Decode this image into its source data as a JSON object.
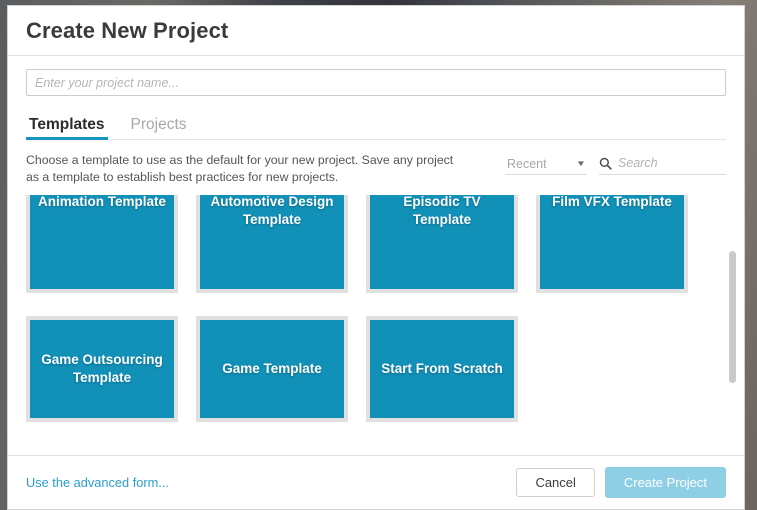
{
  "window": {
    "title": "Create New Project"
  },
  "project_name": {
    "placeholder": "Enter your project name...",
    "value": ""
  },
  "tabs": [
    {
      "label": "Templates",
      "active": true
    },
    {
      "label": "Projects",
      "active": false
    }
  ],
  "description": "Choose a template to use as the default for your new project. Save any project as a template to establish best practices for new projects.",
  "filters": {
    "sort": {
      "selected": "Recent",
      "caret_icon": "chevron-down-icon"
    },
    "search": {
      "icon": "search-icon",
      "placeholder": "Search",
      "value": ""
    }
  },
  "templates": [
    {
      "label": "Animation Template"
    },
    {
      "label": "Automotive Design Template"
    },
    {
      "label": "Episodic TV Template"
    },
    {
      "label": "Film VFX Template"
    },
    {
      "label": "Game Outsourcing Template"
    },
    {
      "label": "Game Template"
    },
    {
      "label": "Start From Scratch"
    }
  ],
  "footer": {
    "advanced_link": "Use the advanced form...",
    "cancel_label": "Cancel",
    "create_label": "Create Project"
  },
  "colors": {
    "accent": "#1694bf",
    "tile": "#1190b8",
    "tile_frame": "#e0e0e0",
    "link": "#2a9fd0",
    "create_disabled": "#8ecfe6",
    "scrollbar": "#c9c9c9"
  }
}
